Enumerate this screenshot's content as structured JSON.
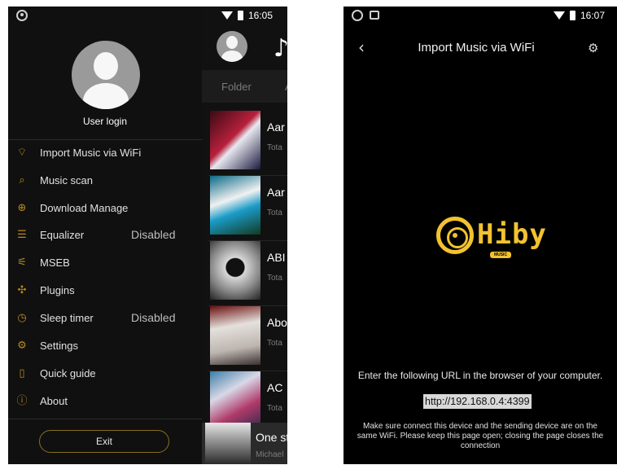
{
  "left_screen": {
    "status_bar": {
      "time": "16:05"
    },
    "drawer": {
      "user_login": "User login",
      "items": [
        {
          "label": "Import Music via WiFi",
          "value": "",
          "icon": "wifi-icon"
        },
        {
          "label": "Music scan",
          "value": "",
          "icon": "scan-icon"
        },
        {
          "label": "Download Manage",
          "value": "",
          "icon": "download-icon"
        },
        {
          "label": "Equalizer",
          "value": "Disabled",
          "icon": "equalizer-icon"
        },
        {
          "label": "MSEB",
          "value": "",
          "icon": "mseb-icon"
        },
        {
          "label": "Plugins",
          "value": "",
          "icon": "plugins-icon"
        },
        {
          "label": "Sleep timer",
          "value": "Disabled",
          "icon": "timer-icon"
        },
        {
          "label": "Settings",
          "value": "",
          "icon": "gear-icon"
        },
        {
          "label": "Quick guide",
          "value": "",
          "icon": "guide-icon"
        },
        {
          "label": "About",
          "value": "",
          "icon": "info-icon"
        }
      ],
      "exit_label": "Exit"
    },
    "background_list": {
      "tabs": [
        "Folder",
        "Al"
      ],
      "rows": [
        {
          "title": "Aar",
          "sub": "Tota"
        },
        {
          "title": "Aar",
          "sub": "Tota"
        },
        {
          "title": "ABI",
          "sub": "Tota"
        },
        {
          "title": "Abo",
          "sub": "Tota"
        },
        {
          "title": "AC",
          "sub": "Tota"
        }
      ],
      "now_playing": {
        "title": "One st",
        "sub": "Michael"
      }
    }
  },
  "right_screen": {
    "status_bar": {
      "time": "16:07"
    },
    "title": "Import Music via WiFi",
    "logo_text": "Hiby",
    "logo_badge": "MUSIC",
    "instruction": "Enter the following URL in the browser of your computer.",
    "url": "http://192.168.0.4:4399",
    "note_lines": [
      "Make sure connect this device and the sending device are on the",
      "same WiFi. Please keep this page open; closing the page closes the",
      "connection"
    ]
  }
}
